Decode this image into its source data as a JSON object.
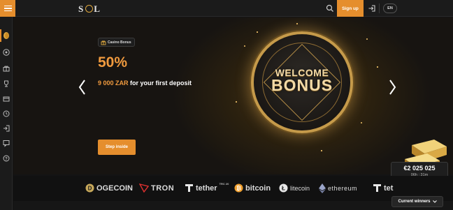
{
  "header": {
    "logo_text_left": "S",
    "logo_text_right": "L",
    "signup_label": "Sign up",
    "language": "EN",
    "icons": [
      "menu-icon",
      "search-icon",
      "login-icon"
    ]
  },
  "sidebar": {
    "icons": [
      "casino-coin-icon",
      "sports-ball-icon",
      "gift-icon",
      "trophy-icon",
      "ticket-icon",
      "history-icon",
      "login-arrow-icon",
      "chat-icon",
      "help-icon"
    ]
  },
  "hero": {
    "badge_label": "Casino Bonus",
    "headline": "50%",
    "offer_amount": "9 000 ZAR",
    "offer_rest": "for your first deposit",
    "cta_label": "Step inside",
    "coin_line1": "WELCOME",
    "coin_line2": "BONUS"
  },
  "jackpot": {
    "amount": "€2 025 025",
    "time": "06h : 31m"
  },
  "crypto": {
    "dogecoin": "OGECOIN",
    "tron": "TRON",
    "tether": "tether",
    "tether_tag": "TRC 20",
    "bitcoin": "bitcoin",
    "litecoin": "litecoin",
    "ethereum": "ethereum",
    "tether2": "tet"
  },
  "winners": {
    "label": "Current winners"
  },
  "colors": {
    "accent": "#e58e2d",
    "headline": "#f09a3e",
    "background": "#141414",
    "gold": "#c59a4a"
  }
}
